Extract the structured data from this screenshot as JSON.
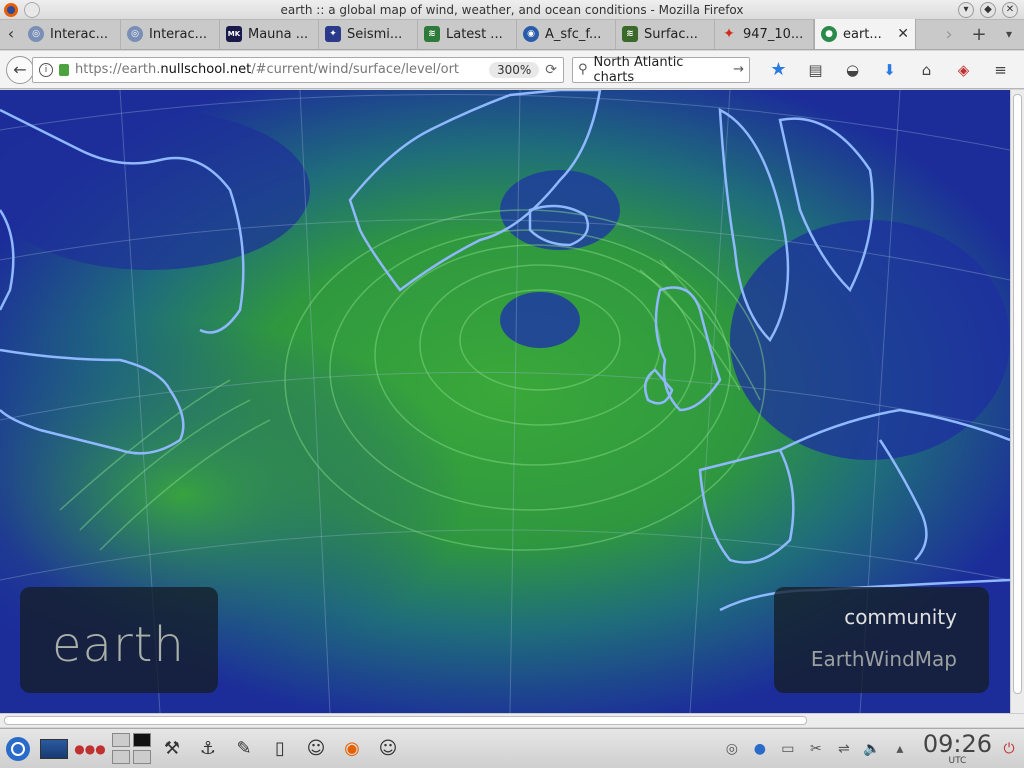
{
  "window": {
    "title": "earth :: a global map of wind, weather, and ocean conditions - Mozilla Firefox",
    "buttons": [
      "▾",
      "◆",
      "✕"
    ]
  },
  "tabs": [
    {
      "label": "Interac...",
      "icon": "globe-icon",
      "color": "#7a8fb5"
    },
    {
      "label": "Interac...",
      "icon": "globe-icon",
      "color": "#7a8fb5"
    },
    {
      "label": "Mauna ...",
      "icon": "mkwc-icon",
      "color": "#1a1a4a"
    },
    {
      "label": "Seismi...",
      "icon": "usgs-icon",
      "color": "#2a3a8a"
    },
    {
      "label": "Latest ...",
      "icon": "wave-icon",
      "color": "#2e7a3a"
    },
    {
      "label": "A_sfc_f...",
      "icon": "noaa-icon",
      "color": "#2a5caa"
    },
    {
      "label": "Surfac...",
      "icon": "wave-icon",
      "color": "#3a6a2a"
    },
    {
      "label": "947_10...",
      "icon": "maple-leaf-icon",
      "color": "#d42a1a"
    },
    {
      "label": "eart...",
      "icon": "earth-icon",
      "color": "#2a8a4a",
      "active": true
    }
  ],
  "nav": {
    "url_prefix": "https://earth.",
    "url_domain": "nullschool.net",
    "url_rest": "/#current/wind/surface/level/ort",
    "zoom": "300%",
    "search_text": "North Atlantic charts"
  },
  "map": {
    "app_label": "earth",
    "community_label": "community",
    "ewm_label": "EarthWindMap"
  },
  "taskbar": {
    "time": "09:26",
    "timezone": "UTC"
  }
}
